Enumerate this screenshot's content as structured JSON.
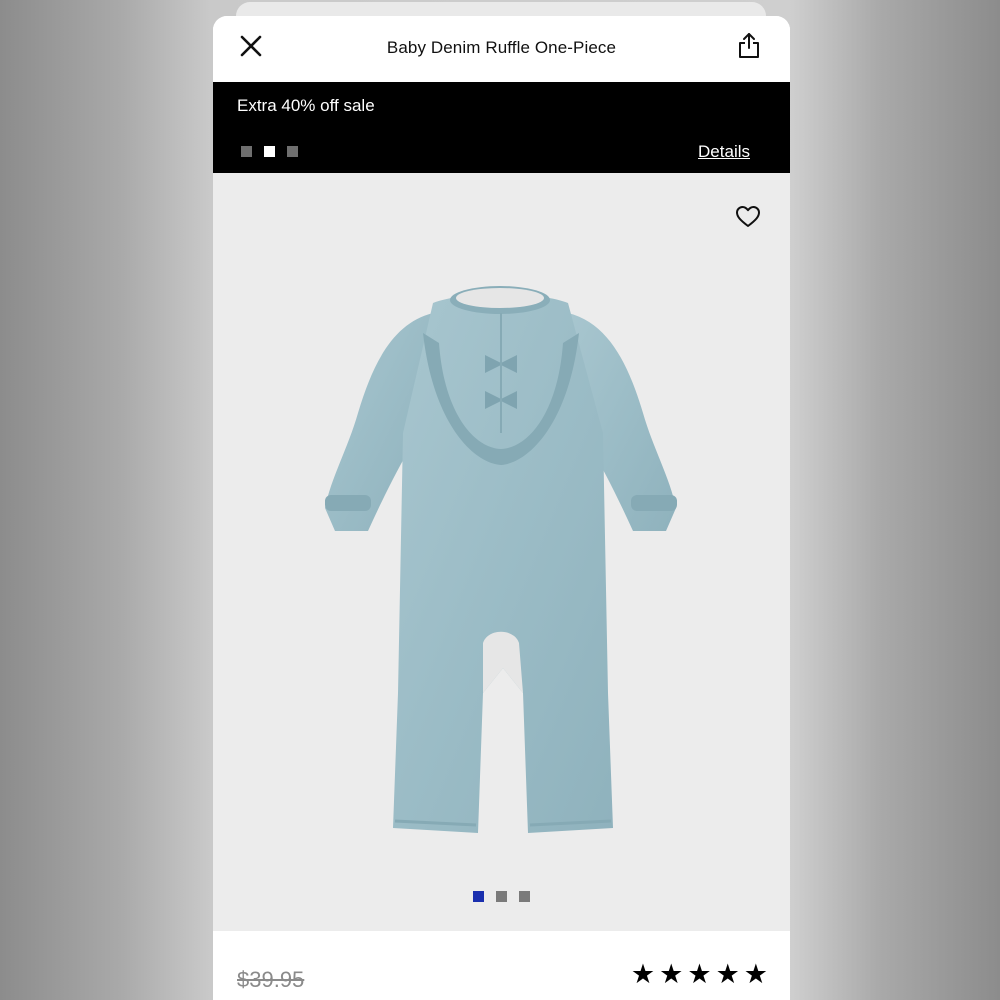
{
  "header": {
    "title": "Baby Denim Ruffle One-Piece",
    "close_icon": "close-icon",
    "share_icon": "share-icon"
  },
  "promo": {
    "text": "Extra 40% off sale",
    "details_label": "Details",
    "slide_count": 3,
    "active_slide": 2
  },
  "product": {
    "favorite_icon": "heart-icon",
    "image_count": 3,
    "active_image": 1,
    "garment_color": "#9fbfc9",
    "active_dot_color": "#1a2fae"
  },
  "price": {
    "original": "$39.95"
  },
  "rating": {
    "stars": [
      "★",
      "★",
      "★",
      "★",
      "★"
    ]
  }
}
